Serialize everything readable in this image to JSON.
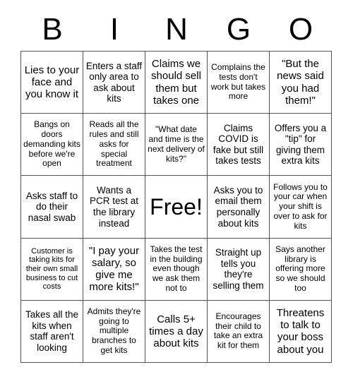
{
  "header": [
    "B",
    "I",
    "N",
    "G",
    "O"
  ],
  "cells": [
    {
      "text": "Lies to your face and you know it",
      "size": "lg"
    },
    {
      "text": "Enters a staff only area to ask about kits",
      "size": "md"
    },
    {
      "text": "Claims we should sell them but takes one",
      "size": "lg"
    },
    {
      "text": "Complains the tests don't work but takes more",
      "size": "sm"
    },
    {
      "text": "\"But the news said you had them!\"",
      "size": "lg"
    },
    {
      "text": "Bangs on doors demanding kits before we're open",
      "size": "sm"
    },
    {
      "text": "Reads all the rules and still asks for special treatment",
      "size": "sm"
    },
    {
      "text": "\"What date and time is the next delivery of kits?\"",
      "size": "sm"
    },
    {
      "text": "Claims COVID is fake but still takes tests",
      "size": "md"
    },
    {
      "text": "Offers you a \"tip\" for giving them extra kits",
      "size": "md"
    },
    {
      "text": "Asks staff to do their nasal swab",
      "size": "md"
    },
    {
      "text": "Wants a PCR test at the library instead",
      "size": "md"
    },
    {
      "text": "Free!",
      "size": "free"
    },
    {
      "text": "Asks you to email them personally about kits",
      "size": "md"
    },
    {
      "text": "Follows you to your car when your shift is over to ask for kits",
      "size": "sm"
    },
    {
      "text": "Customer is taking kits for their own small business to cut costs",
      "size": "xs"
    },
    {
      "text": "\"I pay your salary, so give me more kits!\"",
      "size": "lg"
    },
    {
      "text": "Takes the test in the building even though we ask them not to",
      "size": "sm"
    },
    {
      "text": "Straight up tells you they're selling them",
      "size": "md"
    },
    {
      "text": "Says another library is offering more so we should too",
      "size": "sm"
    },
    {
      "text": "Takes all the kits when staff aren't looking",
      "size": "md"
    },
    {
      "text": "Admits they're going to multiple branches to get kits",
      "size": "sm"
    },
    {
      "text": "Calls 5+ times a day about kits",
      "size": "lg"
    },
    {
      "text": "Encourages their child to take an extra kit for them",
      "size": "sm"
    },
    {
      "text": "Threatens to talk to your boss about you",
      "size": "lg"
    }
  ]
}
